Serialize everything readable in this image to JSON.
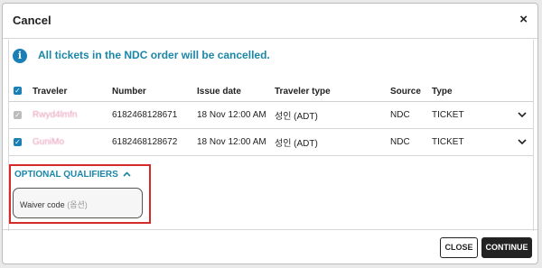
{
  "dialog": {
    "title": "Cancel",
    "close_symbol": "×"
  },
  "info": {
    "icon": "info-icon",
    "icon_glyph": "i",
    "message": "All tickets in the NDC order will be cancelled."
  },
  "table": {
    "headers": {
      "traveler": "Traveler",
      "number": "Number",
      "issue_date": "Issue date",
      "traveler_type": "Traveler type",
      "source": "Source",
      "type": "Type"
    },
    "header_checkbox_checked": true,
    "rows": [
      {
        "checked": true,
        "checkbox_disabled": true,
        "traveler": "Rwyd4lmfn",
        "number": "6182468128671",
        "issue_date": "18 Nov 12:00 AM",
        "traveler_type": "성인 (ADT)",
        "source": "NDC",
        "type": "TICKET"
      },
      {
        "checked": true,
        "checkbox_disabled": false,
        "traveler": "GuniMo",
        "number": "6182468128672",
        "issue_date": "18 Nov 12:00 AM",
        "traveler_type": "성인 (ADT)",
        "source": "NDC",
        "type": "TICKET"
      }
    ]
  },
  "qualifiers": {
    "heading": "OPTIONAL QUALIFIERS",
    "expanded": true,
    "waiver": {
      "label": "Waiver code",
      "optional_hint": "(옵션)"
    }
  },
  "footer": {
    "close_label": "CLOSE",
    "continue_label": "CONTINUE"
  },
  "colors": {
    "accent": "#1a7fb5",
    "info_text": "#1a86a8",
    "highlight_border": "#d42a2a",
    "primary_button": "#222222"
  }
}
